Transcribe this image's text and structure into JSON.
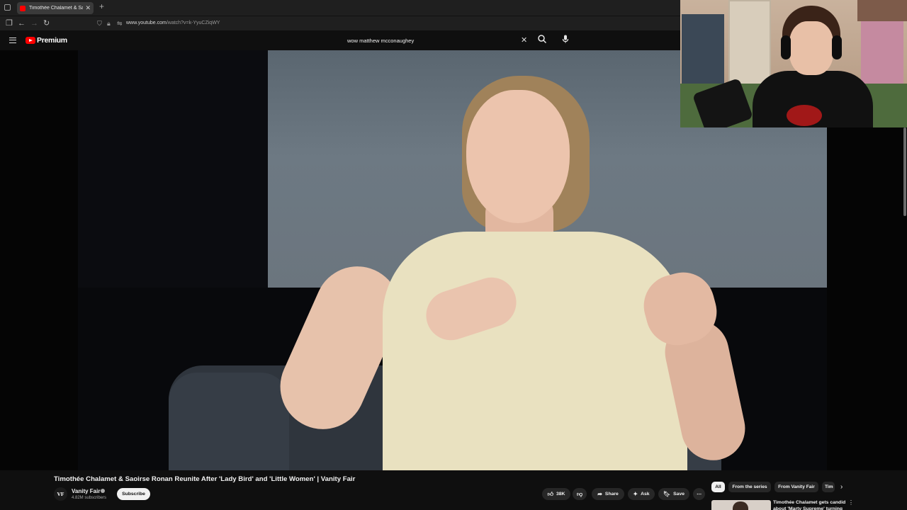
{
  "browser": {
    "tab": {
      "title": "Timothée Chalamet & Saoirse Ronan Reunite After 'Lady Bird' and 'Little Women' | Vanity Fair"
    },
    "url": {
      "host": "www.youtube.com",
      "path": "/watch?v=k-YyuCZiqWY"
    }
  },
  "masthead": {
    "logo_text": "Premium",
    "search": {
      "value": "wow matthew mcconaughey"
    }
  },
  "video": {
    "title": "Timothée Chalamet & Saoirse Ronan Reunite After 'Lady Bird' and 'Little Women' | Vanity Fair"
  },
  "channel": {
    "avatar_text": "VF",
    "name": "Vanity Fair",
    "subscribers": "4.82M subscribers",
    "subscribe_label": "Subscribe"
  },
  "actions": {
    "likes": "38K",
    "share": "Share",
    "ask": "Ask",
    "save": "Save"
  },
  "chips": [
    "All",
    "From the series",
    "From Vanity Fair",
    "Tim"
  ],
  "recommendation": {
    "title": "Timothée Chalamet gets candid about 'Marty Supreme' turning"
  },
  "colors": {
    "background": "#0f0f0f",
    "brand_red": "#ff0000",
    "chip_bg": "#272727"
  }
}
